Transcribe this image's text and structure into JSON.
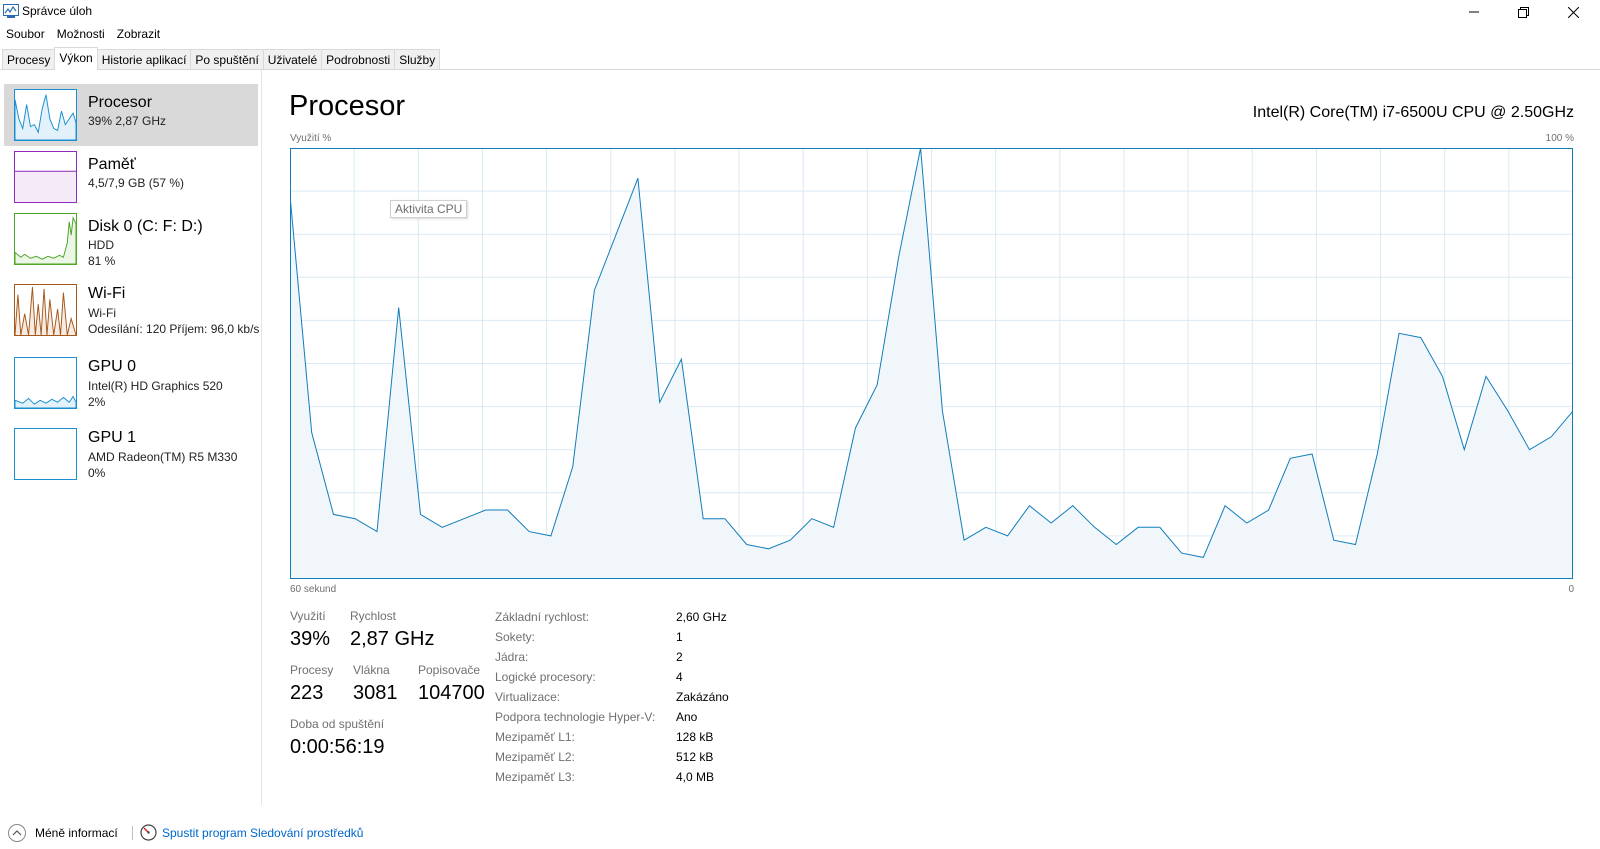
{
  "window": {
    "title": "Správce úloh",
    "icon": "task-manager-icon"
  },
  "menu": [
    "Soubor",
    "Možnosti",
    "Zobrazit"
  ],
  "tabs": [
    {
      "label": "Procesy",
      "active": false
    },
    {
      "label": "Výkon",
      "active": true
    },
    {
      "label": "Historie aplikací",
      "active": false
    },
    {
      "label": "Po spuštění",
      "active": false
    },
    {
      "label": "Uživatelé",
      "active": false
    },
    {
      "label": "Podrobnosti",
      "active": false
    },
    {
      "label": "Služby",
      "active": false
    }
  ],
  "sidebar": {
    "items": [
      {
        "name": "Procesor",
        "line1": "39% 2,87 GHz",
        "line2": "",
        "line3": "",
        "color": "#1a8fd1",
        "active": true
      },
      {
        "name": "Paměť",
        "line1": "4,5/7,9 GB (57 %)",
        "line2": "",
        "line3": "",
        "color": "#8e2bba",
        "active": false
      },
      {
        "name": "Disk 0 (C: F: D:)",
        "line1": "HDD",
        "line2": "81 %",
        "line3": "",
        "color": "#4da626",
        "active": false
      },
      {
        "name": "Wi-Fi",
        "line1": "Wi-Fi",
        "line2": "Odesílání: 120 Příjem: 96,0 kb/s",
        "line3": "",
        "color": "#a7571a",
        "active": false
      },
      {
        "name": "GPU 0",
        "line1": "Intel(R) HD Graphics 520",
        "line2": "2%",
        "line3": "",
        "color": "#1a8fd1",
        "active": false
      },
      {
        "name": "GPU 1",
        "line1": "AMD Radeon(TM) R5 M330",
        "line2": "0%",
        "line3": "",
        "color": "#1a8fd1",
        "active": false
      }
    ]
  },
  "main": {
    "title": "Procesor",
    "cpu_model": "Intel(R) Core(TM) i7-6500U CPU @ 2.50GHz",
    "axis_top_left": "Využití %",
    "axis_top_right": "100 %",
    "axis_bottom_left": "60 sekund",
    "axis_bottom_right": "0",
    "tooltip": "Aktivita CPU",
    "accent": "#117dbb",
    "fill": "#f1f6fa",
    "grid": "#d9eaf4"
  },
  "chart_data": {
    "type": "area",
    "x_range": [
      60,
      0
    ],
    "ylim": [
      0,
      100
    ],
    "grid": true,
    "values": [
      89,
      34,
      15,
      14,
      11,
      63,
      15,
      12,
      14,
      16,
      16,
      11,
      10,
      26,
      67,
      80,
      93,
      41,
      51,
      14,
      14,
      8,
      7,
      9,
      14,
      12,
      35,
      45,
      75,
      100,
      39,
      9,
      12,
      10,
      17,
      13,
      17,
      12,
      8,
      12,
      12,
      6,
      5,
      17,
      13,
      16,
      28,
      29,
      9,
      8,
      29,
      57,
      56,
      47,
      30,
      47,
      39,
      30,
      33,
      39
    ]
  },
  "stats": {
    "utilization_label": "Využití",
    "utilization_value": "39%",
    "speed_label": "Rychlost",
    "speed_value": "2,87 GHz",
    "processes_label": "Procesy",
    "processes_value": "223",
    "threads_label": "Vlákna",
    "threads_value": "3081",
    "handles_label": "Popisovače",
    "handles_value": "104700",
    "uptime_label": "Doba od spuštění",
    "uptime_value": "0:00:56:19"
  },
  "specs": [
    {
      "label": "Základní rychlost:",
      "value": "2,60 GHz"
    },
    {
      "label": "Sokety:",
      "value": "1"
    },
    {
      "label": "Jádra:",
      "value": "2"
    },
    {
      "label": "Logické procesory:",
      "value": "4"
    },
    {
      "label": "Virtualizace:",
      "value": "Zakázáno"
    },
    {
      "label": "Podpora technologie Hyper-V:",
      "value": "Ano"
    },
    {
      "label": "Mezipaměť L1:",
      "value": "128 kB"
    },
    {
      "label": "Mezipaměť L2:",
      "value": "512 kB"
    },
    {
      "label": "Mezipaměť L3:",
      "value": "4,0 MB"
    }
  ],
  "footer": {
    "less_info": "Méně informací",
    "resource_monitor": "Spustit program Sledování prostředků"
  }
}
